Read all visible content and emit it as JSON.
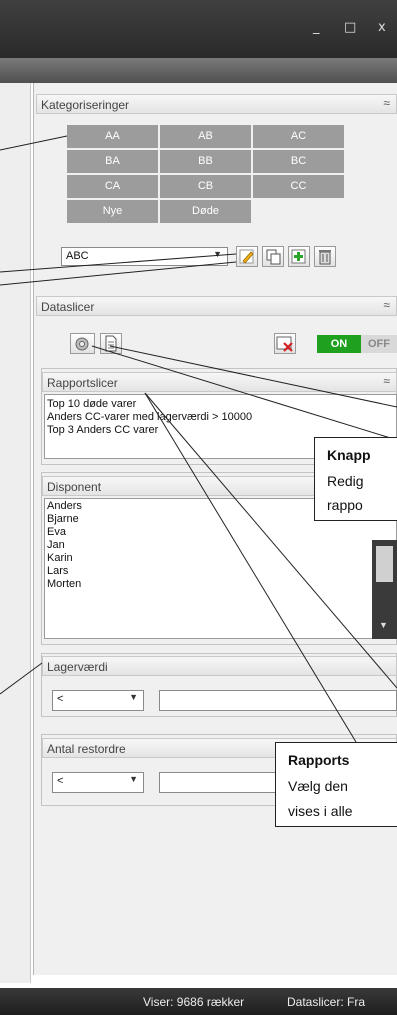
{
  "window": {
    "minimize": "_",
    "maximize": "□",
    "close": "x"
  },
  "kategoriseringer": {
    "title": "Kategoriseringer",
    "tiles": [
      "AA",
      "AB",
      "AC",
      "BA",
      "BB",
      "BC",
      "CA",
      "CB",
      "CC",
      "Nye",
      "Døde"
    ],
    "selected": "ABC"
  },
  "dataslicer": {
    "title": "Dataslicer",
    "toggle_on": "ON",
    "toggle_off": "OFF"
  },
  "rapportslicer": {
    "title": "Rapportslicer",
    "items": [
      "Top 10 døde varer",
      "Anders CC-varer med lagerværdi > 10000",
      "Top 3 Anders CC varer"
    ]
  },
  "disponent": {
    "title": "Disponent",
    "items": [
      "Anders",
      "Bjarne",
      "Eva",
      "Jan",
      "Karin",
      "Lars",
      "Morten"
    ]
  },
  "lagervaerdi": {
    "title": "Lagerværdi",
    "operator": "<"
  },
  "restordre": {
    "title": "Antal restordre",
    "operator": "<"
  },
  "status": {
    "rows": "Viser: 9686 rækker",
    "slicer": "Dataslicer: Fra"
  },
  "callouts": {
    "knap_title": "Knapp",
    "knap_line1": "Redig",
    "knap_line2": "rappo",
    "rapport_title": "Rapports",
    "rapport_line1": "Vælg den",
    "rapport_line2": "vises i alle"
  }
}
